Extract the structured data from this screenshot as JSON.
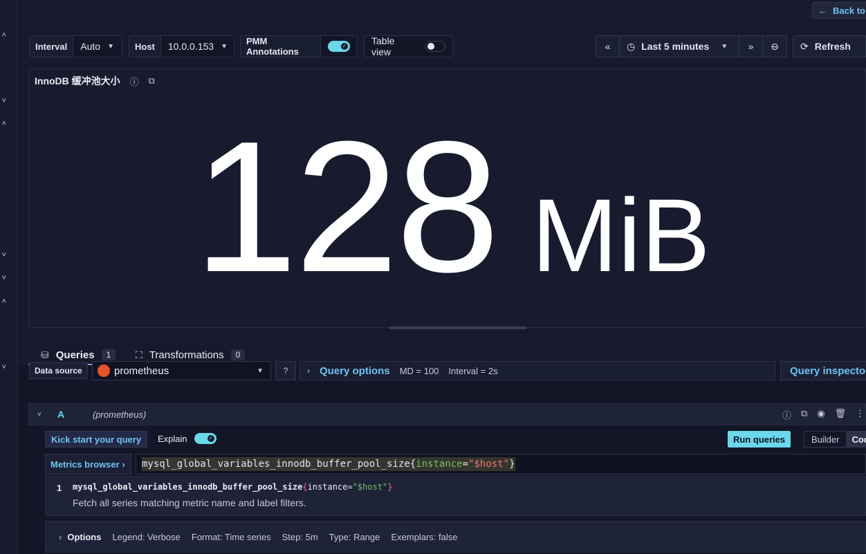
{
  "back_button": {
    "label": "Back to"
  },
  "toolbar": {
    "interval": {
      "label": "Interval",
      "value": "Auto"
    },
    "host": {
      "label": "Host",
      "value": "10.0.0.153"
    },
    "pmm_annotations": {
      "label": "PMM Annotations",
      "enabled": true
    },
    "table_view": {
      "label": "Table view",
      "enabled": false
    },
    "time_range": "Last 5 minutes",
    "refresh_label": "Refresh"
  },
  "panel": {
    "title": "InnoDB 缓冲池大小",
    "value": "128",
    "unit": "MiB"
  },
  "tabs": [
    {
      "label": "Queries",
      "count": "1"
    },
    {
      "label": "Transformations",
      "count": "0"
    }
  ],
  "datasource": {
    "label": "Data source",
    "name": "prometheus"
  },
  "query_options": {
    "title": "Query options",
    "md": "MD = 100",
    "interval": "Interval = 2s"
  },
  "query_inspector": "Query inspector",
  "query": {
    "ref": "A",
    "datasource": "(prometheus)",
    "kick_start": "Kick start your query",
    "explain_label": "Explain",
    "run_label": "Run queries",
    "mode_builder": "Builder",
    "mode_code": "Cod",
    "metrics_browser": "Metrics browser ›",
    "expr_metric": "mysql_global_variables_innodb_buffer_pool_size",
    "expr_label": "instance",
    "expr_value": "\"$host\"",
    "suggestion_num": "1",
    "suggestion_desc": "Fetch all series matching metric name and label filters.",
    "options": {
      "title": "Options",
      "legend": "Legend: Verbose",
      "format": "Format: Time series",
      "step": "Step: 5m",
      "type": "Type: Range",
      "exemplars": "Exemplars: false"
    }
  },
  "colors": {
    "accent": "#6ad8ea",
    "link": "#6ec2f5",
    "background": "#161a2c"
  }
}
